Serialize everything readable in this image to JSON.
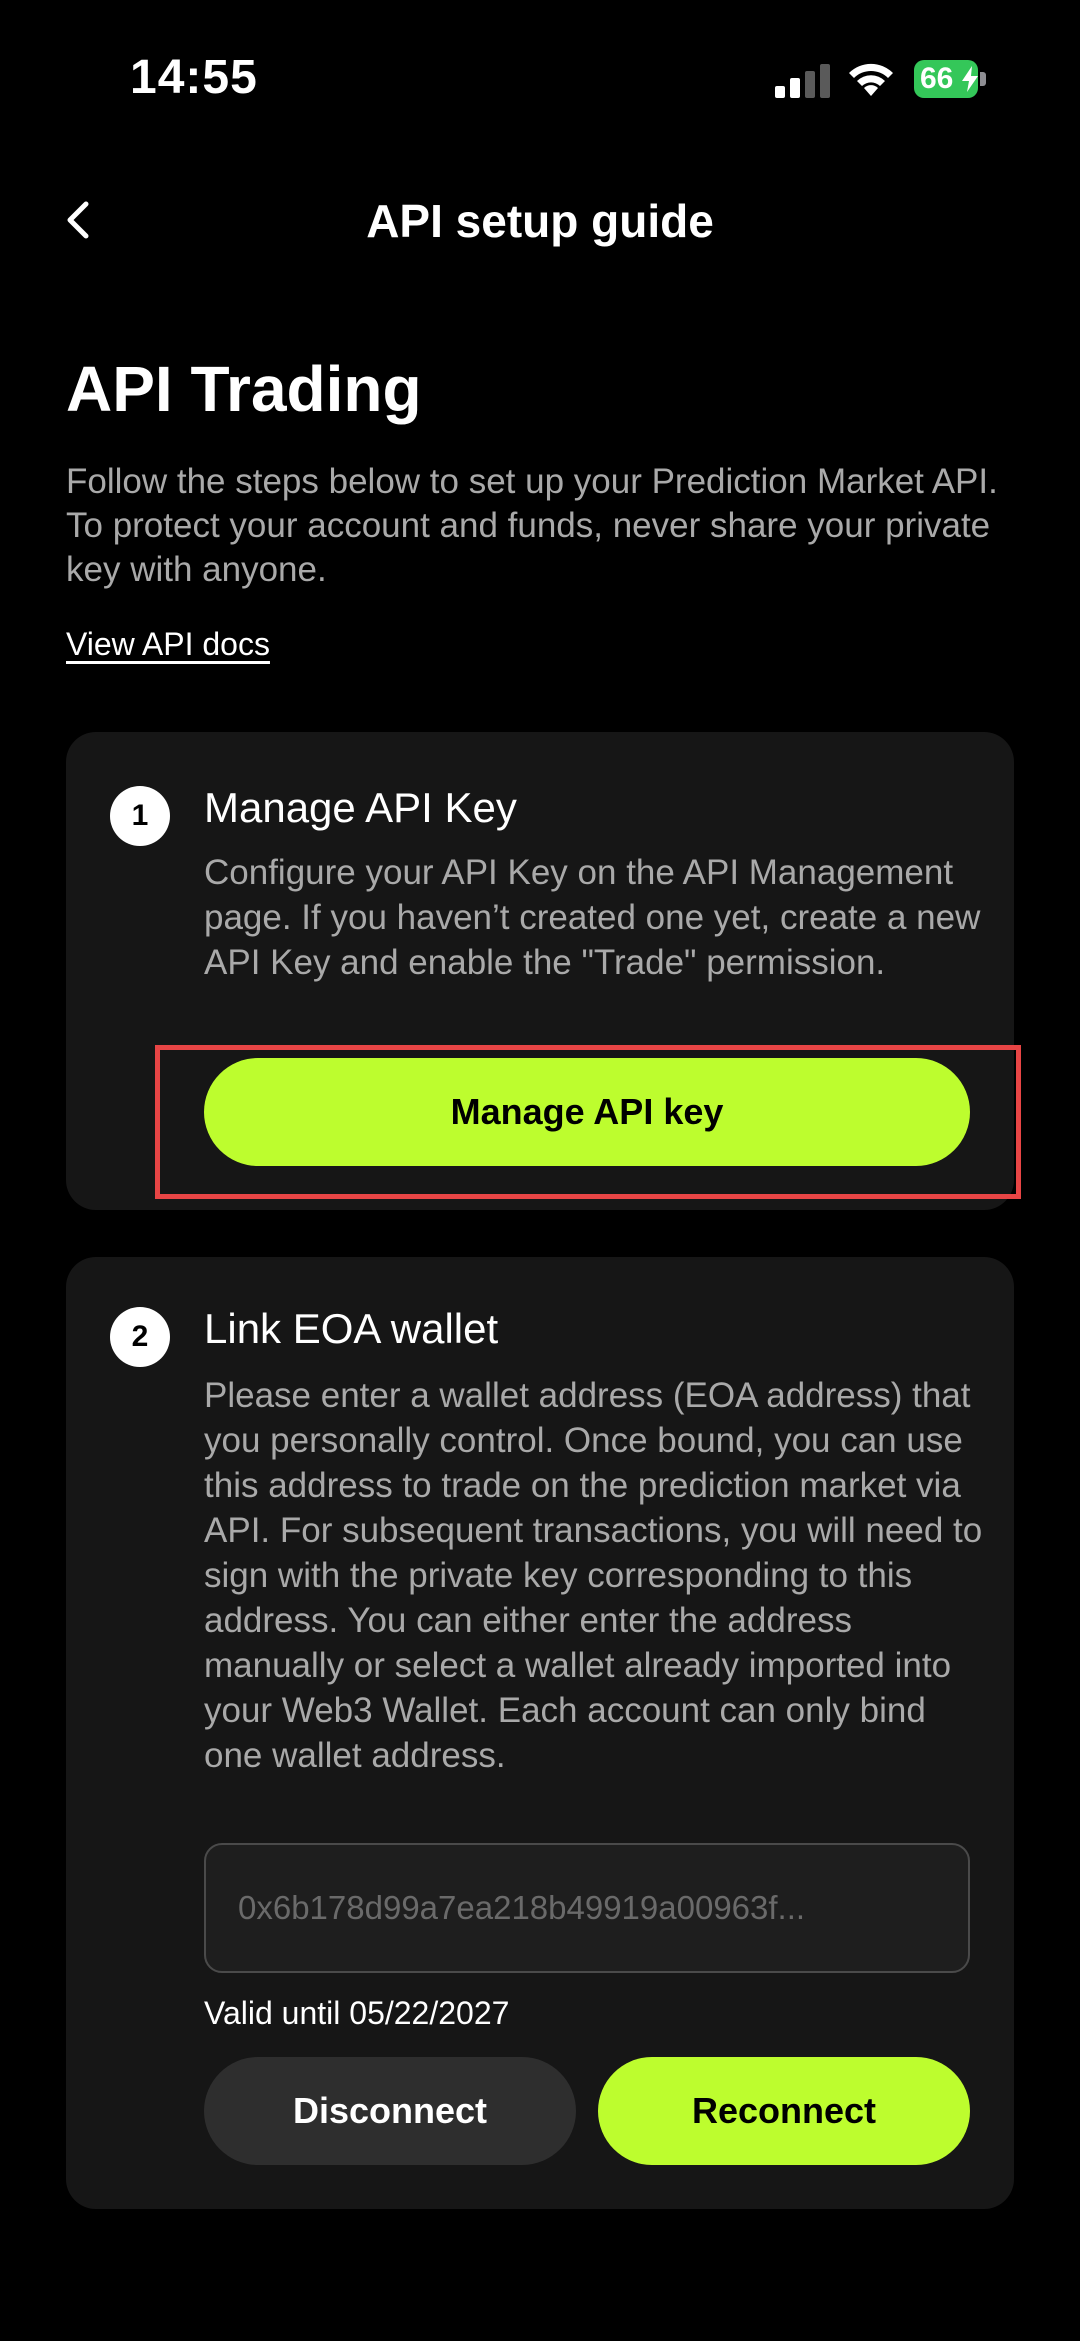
{
  "status_bar": {
    "time": "14:55",
    "battery": "66"
  },
  "header": {
    "title": "API setup guide"
  },
  "intro": {
    "title": "API Trading",
    "description": "Follow the steps below to set up your Prediction Market API. To protect your account and funds, never share your private key with anyone.",
    "docs_link": "View API docs"
  },
  "steps": [
    {
      "number": "1",
      "title": "Manage API Key",
      "description": "Configure your API Key on the API Management page. If you haven’t created one yet, create a new API Key and enable the \"Trade\" permission.",
      "button_label": "Manage API key"
    },
    {
      "number": "2",
      "title": "Link EOA wallet",
      "description": "Please enter a wallet address (EOA address) that you personally control. Once bound, you can use this address to trade on the prediction market via API. For subsequent transactions, you will need to sign with the private key corresponding to this address. You can either enter the address manually or select a wallet already imported into your Web3 Wallet. Each account can only bind one wallet address.",
      "address_value": "0x6b178d99a7ea218b49919a00963f...",
      "valid_until": "Valid until 05/22/2027",
      "disconnect_label": "Disconnect",
      "reconnect_label": "Reconnect"
    }
  ],
  "colors": {
    "accent": "#bdfd2e",
    "highlight": "#e84545",
    "battery": "#34c759"
  }
}
